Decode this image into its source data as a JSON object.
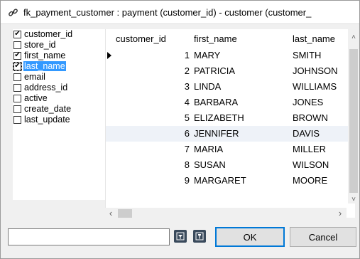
{
  "title": "fk_payment_customer : payment (customer_id) - customer (customer_",
  "columns_list": [
    {
      "label": "customer_id",
      "checked": true,
      "selected": false
    },
    {
      "label": "store_id",
      "checked": false,
      "selected": false
    },
    {
      "label": "first_name",
      "checked": true,
      "selected": false
    },
    {
      "label": "last_name",
      "checked": true,
      "selected": true
    },
    {
      "label": "email",
      "checked": false,
      "selected": false
    },
    {
      "label": "address_id",
      "checked": false,
      "selected": false
    },
    {
      "label": "active",
      "checked": false,
      "selected": false
    },
    {
      "label": "create_date",
      "checked": false,
      "selected": false
    },
    {
      "label": "last_update",
      "checked": false,
      "selected": false
    }
  ],
  "grid": {
    "headers": [
      "customer_id",
      "first_name",
      "last_name"
    ],
    "rows": [
      [
        "1",
        "MARY",
        "SMITH"
      ],
      [
        "2",
        "PATRICIA",
        "JOHNSON"
      ],
      [
        "3",
        "LINDA",
        "WILLIAMS"
      ],
      [
        "4",
        "BARBARA",
        "JONES"
      ],
      [
        "5",
        "ELIZABETH",
        "BROWN"
      ],
      [
        "6",
        "JENNIFER",
        "DAVIS"
      ],
      [
        "7",
        "MARIA",
        "MILLER"
      ],
      [
        "8",
        "SUSAN",
        "WILSON"
      ],
      [
        "9",
        "MARGARET",
        "MOORE"
      ]
    ],
    "current_row": 0,
    "highlight_row": 5
  },
  "bottom": {
    "search_value": "",
    "ok_label": "OK",
    "cancel_label": "Cancel"
  },
  "icons": {
    "title_icon": "link-icon",
    "filter_icon": "filter-icon",
    "options_icon": "wrench-icon"
  },
  "colors": {
    "selection": "#3399ff",
    "alt_row": "#eef2f8",
    "accent": "#0078d7"
  }
}
